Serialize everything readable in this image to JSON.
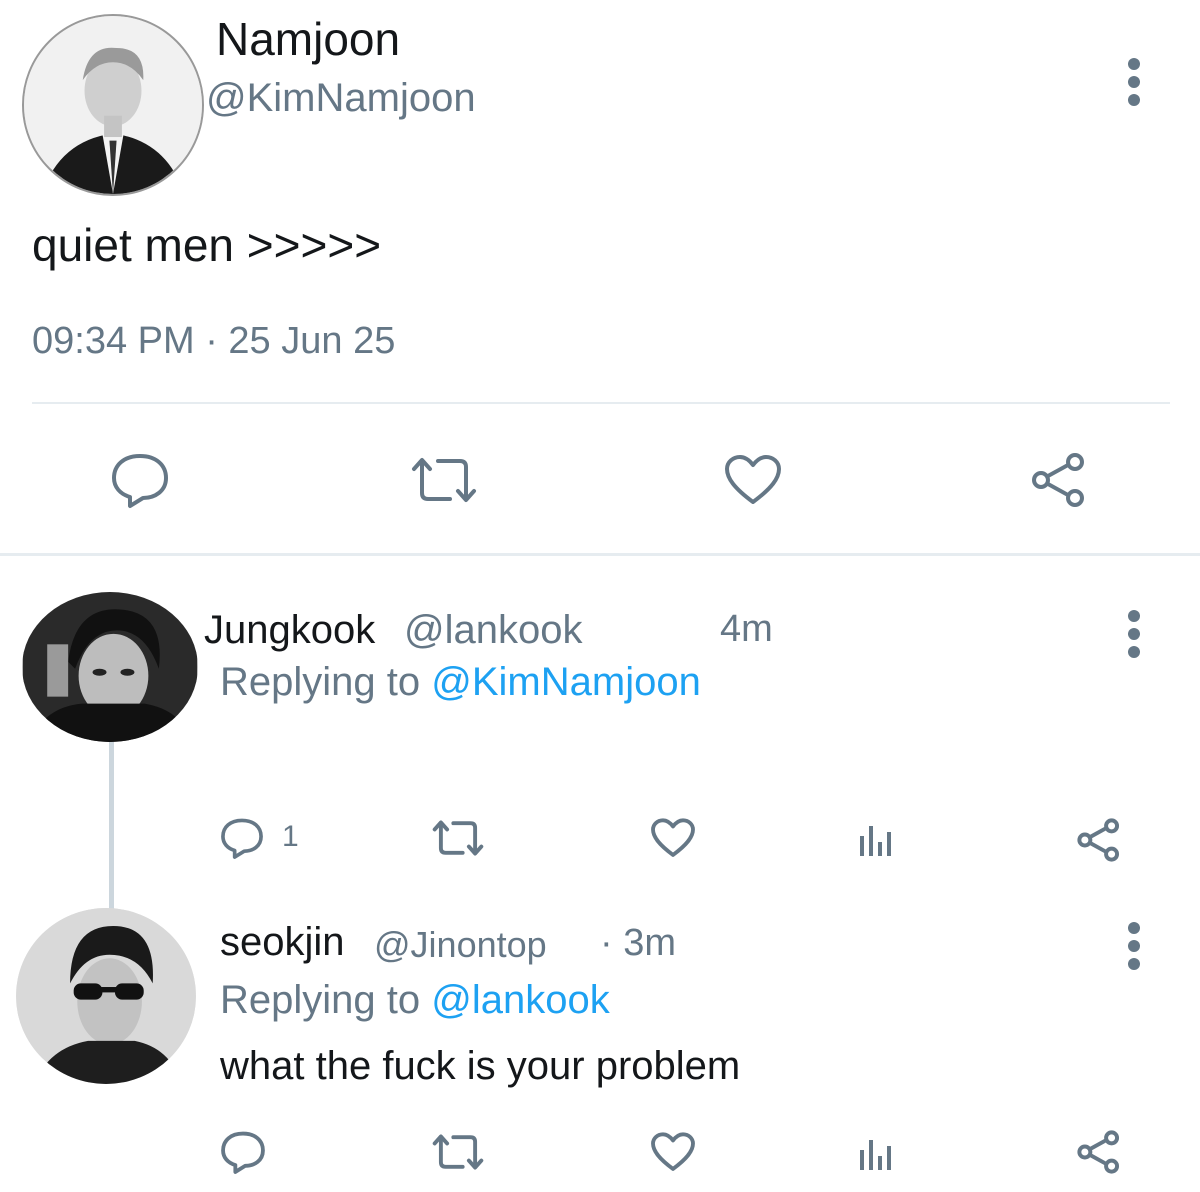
{
  "main_tweet": {
    "name": "Namjoon",
    "handle": "@KimNamjoon",
    "text": "quiet men >>>>>",
    "timestamp": "09:34 PM · 25 Jun 25",
    "actions": [
      "reply-icon",
      "retweet-icon",
      "like-icon",
      "share-icon"
    ]
  },
  "replies": [
    {
      "name": "Jungkook",
      "handle": "@lankook",
      "time": "4m",
      "replying_label": "Replying to",
      "replying_to": "@KimNamjoon",
      "text": "",
      "reply_count": "1",
      "actions": [
        "reply-icon",
        "retweet-icon",
        "like-icon",
        "analytics-icon",
        "share-icon"
      ]
    },
    {
      "name": "seokjin",
      "handle": "@Jinontop",
      "time": "· 3m",
      "replying_label": "Replying to",
      "replying_to": "@lankook",
      "text": "what the fuck is your problem",
      "actions": [
        "reply-icon",
        "retweet-icon",
        "like-icon",
        "analytics-icon",
        "share-icon"
      ]
    }
  ],
  "colors": {
    "text": "#14171a",
    "secondary": "#657786",
    "mention": "#1da1f2",
    "divider": "#e6ecf0"
  }
}
